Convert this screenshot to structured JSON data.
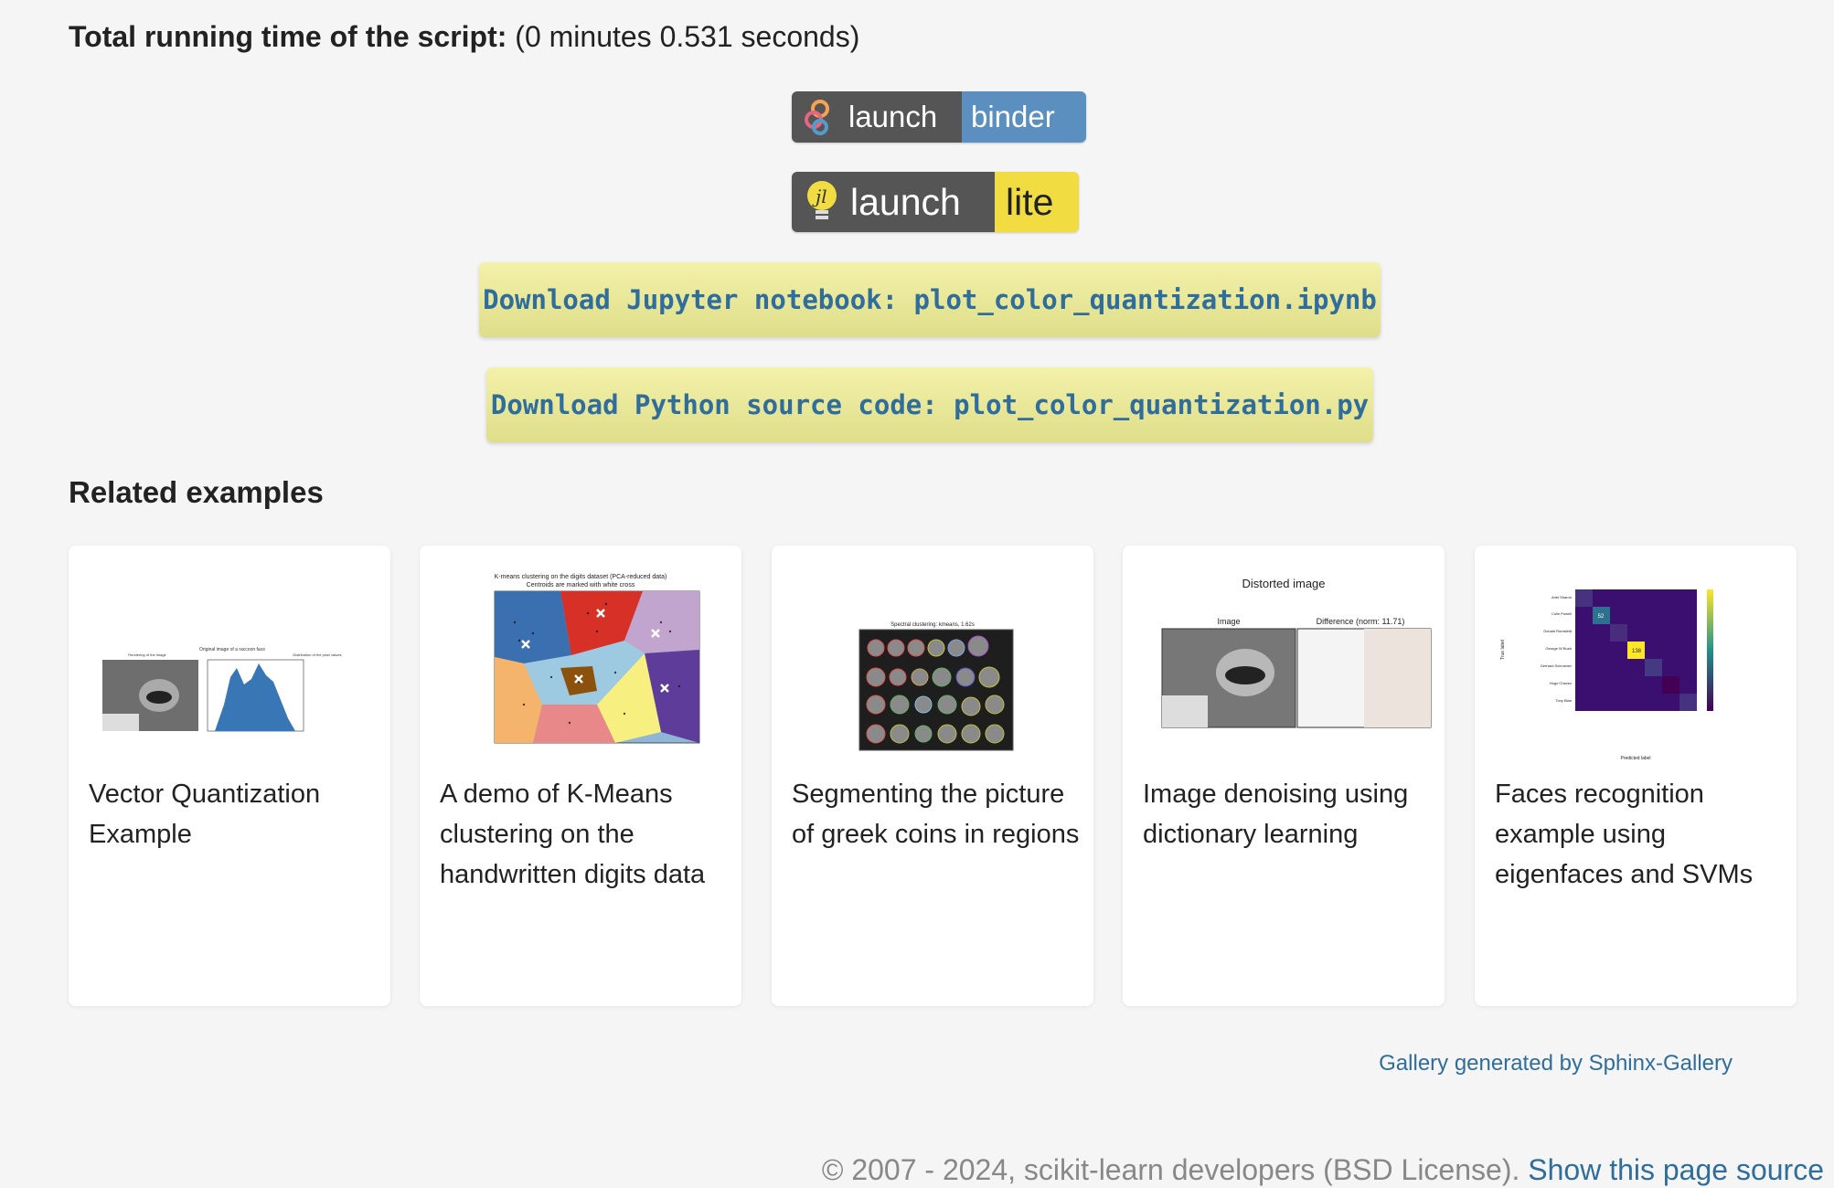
{
  "runtime": {
    "label": "Total running time of the script:",
    "value": "(0 minutes 0.531 seconds)"
  },
  "binder_badge": {
    "left": "launch",
    "right": "binder"
  },
  "lite_badge": {
    "left": "launch",
    "right": "lite"
  },
  "downloads": {
    "notebook": "Download Jupyter notebook: plot_color_quantization.ipynb",
    "python": "Download Python source code: plot_color_quantization.py"
  },
  "related_title": "Related examples",
  "cards": [
    {
      "caption": "Vector Quantization Example",
      "thumb_title": "Original image of a raccoon face",
      "thumb_sub1": "Rendering of the image",
      "thumb_sub2": "Distribution of the pixel values"
    },
    {
      "caption": "A demo of K-Means clustering on the handwritten digits data",
      "thumb_title": "K-means clustering on the digits dataset (PCA-reduced data)",
      "thumb_sub1": "Centroids are marked with white cross"
    },
    {
      "caption": "Segmenting the picture of greek coins in regions",
      "thumb_title": "Spectral clustering: kmeans, 1.62s"
    },
    {
      "caption": "Image denoising using dictionary learning",
      "thumb_title": "Distorted image",
      "thumb_sub1": "Image",
      "thumb_sub2": "Difference (norm: 11.71)"
    },
    {
      "caption": "Faces recognition example using eigenfaces and SVMs",
      "thumb_title": "Predicted label",
      "thumb_sub1": "True label"
    }
  ],
  "gallery_link": "Gallery generated by Sphinx-Gallery",
  "footer": {
    "copyright": "© 2007 - 2024, scikit-learn developers (BSD License).",
    "source_link": "Show this page source"
  },
  "colors": {
    "link": "#2f6d9c",
    "binder_blue": "#5b8fbf",
    "lite_yellow": "#f1dd41",
    "badge_gray": "#555555"
  }
}
